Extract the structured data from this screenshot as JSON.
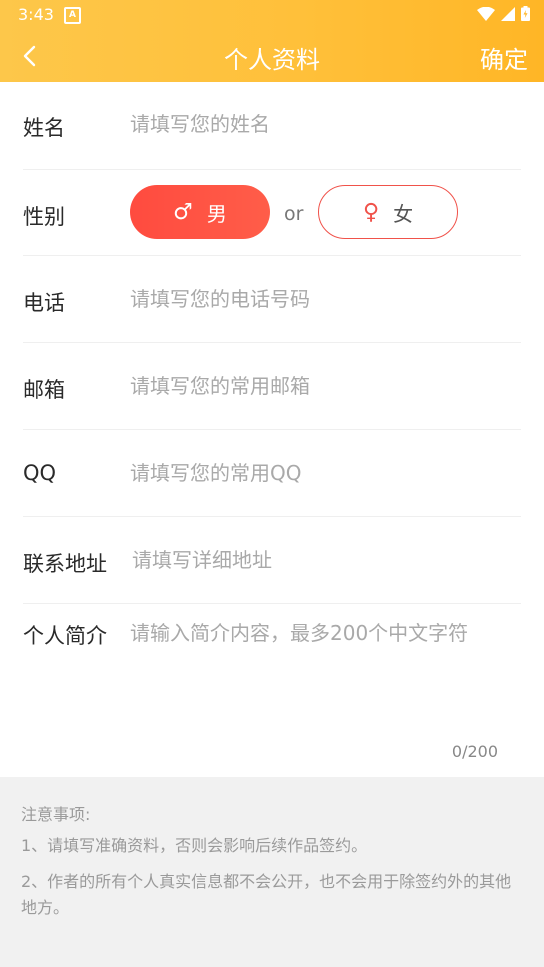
{
  "status_bar": {
    "time": "3:43",
    "notification_badge": "A"
  },
  "header": {
    "back_icon": "chevron-left-icon",
    "title": "个人资料",
    "confirm_label": "确定"
  },
  "form": {
    "name": {
      "label": "姓名",
      "placeholder": "请填写您的姓名"
    },
    "gender": {
      "label": "性别",
      "male_label": "男",
      "male_symbol": "♂",
      "or_text": "or",
      "female_label": "女",
      "female_symbol": "♀",
      "selected": "男"
    },
    "phone": {
      "label": "电话",
      "placeholder": "请填写您的电话号码"
    },
    "email": {
      "label": "邮箱",
      "placeholder": "请填写您的常用邮箱"
    },
    "qq": {
      "label": "QQ",
      "placeholder": "请填写您的常用QQ"
    },
    "address": {
      "label": "联系地址",
      "placeholder": "请填写详细地址"
    },
    "intro": {
      "label": "个人简介",
      "placeholder": "请输入简介内容，最多200个中文字符",
      "counter": "0/200"
    }
  },
  "notes": {
    "title": "注意事项:",
    "items": [
      "1、请填写准确资料，否则会影响后续作品签约。",
      "2、作者的所有个人真实信息都不会公开，也不会用于除签约外的其他地方。"
    ]
  },
  "colors": {
    "header_start": "#fdc74a",
    "header_end": "#ffb626",
    "accent_red": "#ff4b3f"
  }
}
